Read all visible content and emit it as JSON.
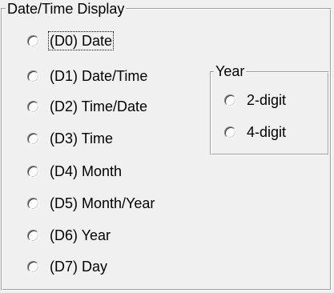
{
  "date_time_group": {
    "caption": "Date/Time Display",
    "options": [
      {
        "label": "(D0) Date",
        "selected": false,
        "focused": true
      },
      {
        "label": "(D1) Date/Time",
        "selected": false
      },
      {
        "label": "(D2) Time/Date",
        "selected": false
      },
      {
        "label": "(D3) Time",
        "selected": false
      },
      {
        "label": "(D4) Month",
        "selected": false
      },
      {
        "label": "(D5) Month/Year",
        "selected": false
      },
      {
        "label": "(D6) Year",
        "selected": false
      },
      {
        "label": "(D7) Day",
        "selected": false
      }
    ]
  },
  "year_group": {
    "caption": "Year",
    "options": [
      {
        "label": "2-digit",
        "selected": false
      },
      {
        "label": "4-digit",
        "selected": false
      }
    ]
  }
}
